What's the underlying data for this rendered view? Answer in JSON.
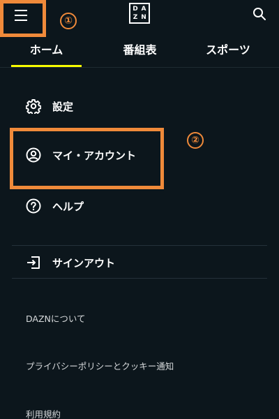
{
  "header": {
    "menu_icon": "hamburger-menu-icon",
    "logo": {
      "l1": "D",
      "l2": "A",
      "l3": "Z",
      "l4": "N"
    },
    "search_icon": "search-icon"
  },
  "tabs": [
    {
      "label": "ホーム",
      "active": true
    },
    {
      "label": "番組表",
      "active": false
    },
    {
      "label": "スポーツ",
      "active": false
    }
  ],
  "menu": {
    "items": [
      {
        "icon": "gear-icon",
        "label": "設定"
      },
      {
        "icon": "user-circle-icon",
        "label": "マイ・アカウント"
      },
      {
        "icon": "question-circle-icon",
        "label": "ヘルプ"
      },
      {
        "icon": "sign-out-icon",
        "label": "サインアウト"
      }
    ],
    "links": [
      {
        "label": "DAZNについて"
      },
      {
        "label": "プライバシーポリシーとクッキー通知"
      },
      {
        "label": "利用規約"
      }
    ]
  },
  "annotations": [
    {
      "label": "①"
    },
    {
      "label": "②"
    }
  ],
  "colors": {
    "background": "#0c161c",
    "accent": "#f8fc00",
    "annotation": "#f08a3a"
  }
}
